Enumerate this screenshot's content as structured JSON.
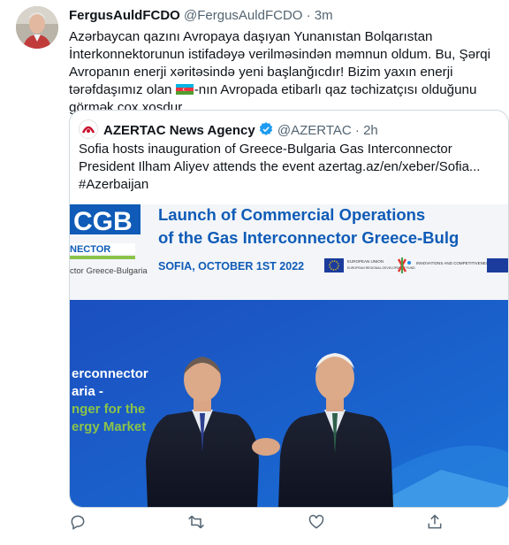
{
  "tweet": {
    "display_name": "FergusAuldFCDO",
    "handle": "@FergusAuldFCDO",
    "separator": "·",
    "time": "3m",
    "text_part1": "Azərbaycan qazını Avropaya daşıyan Yunanıstan Bolqarıstan İnterkonnektorunun istifadəyə verilməsindən məmnun oldum. Bu, Şərqi Avropanın enerji xəritəsində yeni başlanğıcdır! Bizim yaxın enerji tərəfdaşımız olan ",
    "text_part2": "-nın Avropada etibarlı qaz təchizatçısı olduğunu görmək çox xoşdur"
  },
  "quote": {
    "display_name": "AZERTAC News Agency",
    "handle": "@AZERTAC",
    "separator": "·",
    "time": "2h",
    "line1": "Sofia hosts inauguration of Greece-Bulgaria Gas Interconnector",
    "line2": "President Ilham Aliyev attends the event azertag.az/en/xeber/Sofia...",
    "line3": "#Azerbaijan"
  },
  "media": {
    "logo_text": "CGB",
    "logo_sub": "NECTOR",
    "logo_caption": "ctor Greece-Bulgaria",
    "headline1": "Launch of Commercial Operations",
    "headline2": "of the Gas Interconnector Greece-Bulg",
    "date_text": "SOFIA, OCTOBER 1ST 2022",
    "eu_text": "EUROPEAN UNION",
    "eu_sub": "EUROPEAN REGIONAL DEVELOPMENT FUND",
    "innov_text": "INNOVATIONS AND COMPETITIVENESS",
    "banner1": "erconnector",
    "banner2": "aria  -",
    "banner3": "nger for the",
    "banner4": "ergy Market"
  },
  "icons": [
    "reply-icon",
    "retweet-icon",
    "like-icon",
    "share-icon"
  ],
  "colors": {
    "accent": "#1d9bf0",
    "media_blue": "#1a56c8",
    "green": "#8bc34a"
  }
}
